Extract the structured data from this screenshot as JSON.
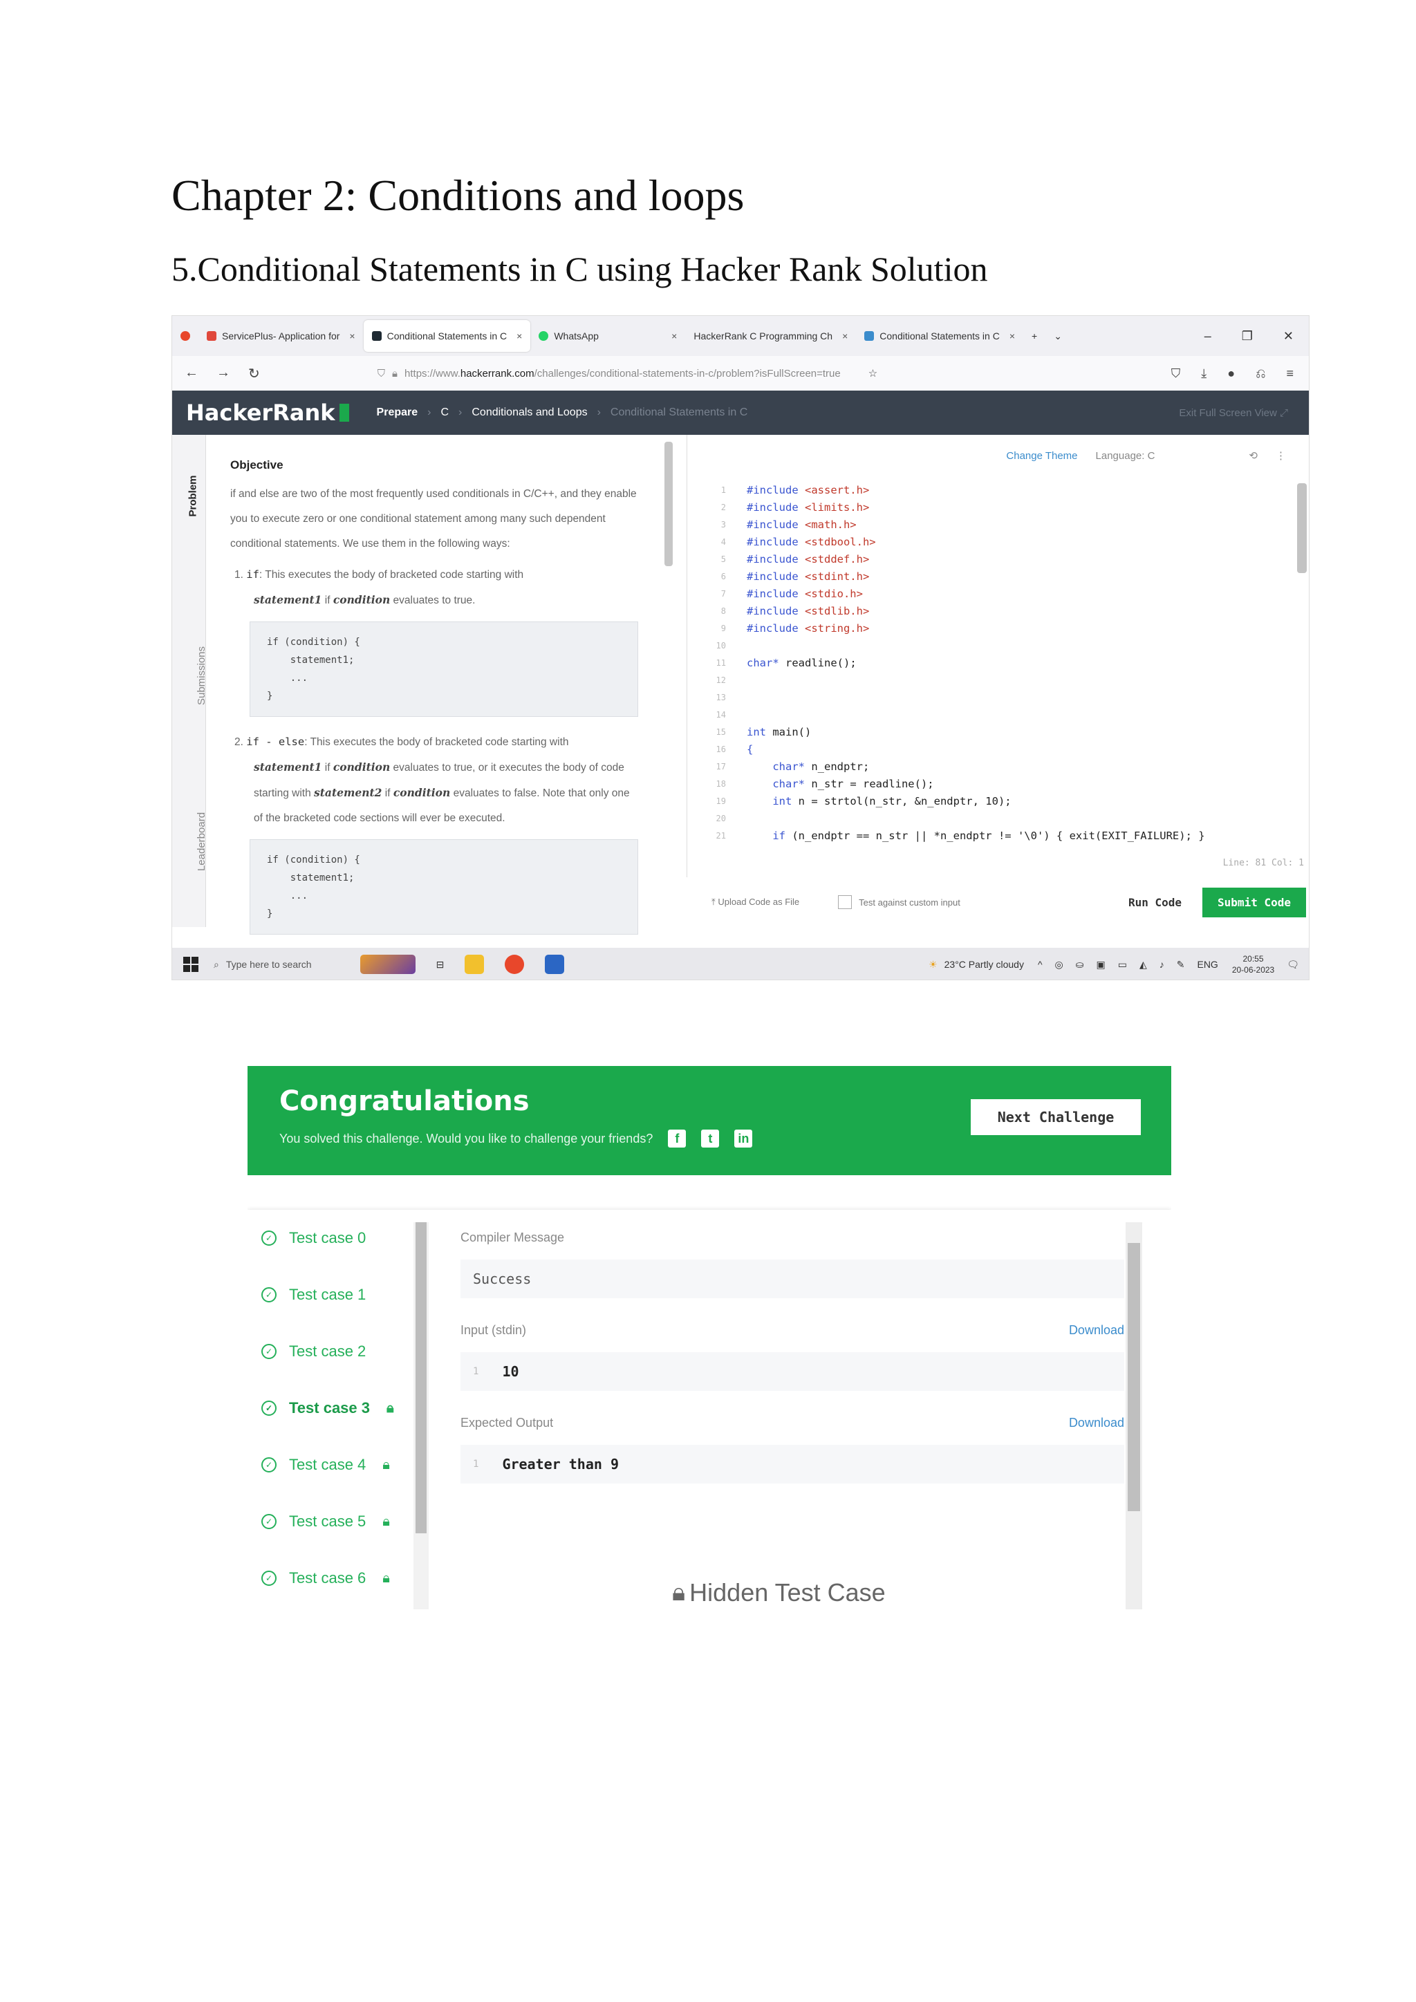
{
  "document": {
    "chapter_title": "Chapter 2: Conditions and loops",
    "section_title": "5.Conditional Statements in C using Hacker Rank Solution"
  },
  "browser": {
    "tabs": [
      {
        "label": "ServicePlus- Application for"
      },
      {
        "label": "Conditional Statements in C"
      },
      {
        "label": "WhatsApp"
      },
      {
        "label": "HackerRank C Programming Ch"
      },
      {
        "label": "Conditional Statements in C"
      }
    ],
    "url_prefix": "https://www.",
    "url_domain": "hackerrank.com",
    "url_path": "/challenges/conditional-statements-in-c/problem?isFullScreen=true"
  },
  "hackerrank": {
    "logo": "HackerRank",
    "breadcrumb": [
      "Prepare",
      "C",
      "Conditionals and Loops",
      "Conditional Statements in C"
    ],
    "exit_fullscreen": "Exit Full Screen View",
    "side_tabs": [
      "Problem",
      "Submissions",
      "Leaderboard"
    ],
    "objective_heading": "Objective",
    "objective_text": "if and else are two of the most frequently used conditionals in C/C++, and they enable you to execute zero or one conditional statement among many such dependent conditional statements. We use them in the following ways:",
    "item1_kw": "if",
    "item1_text": ": This executes the body of bracketed code starting with",
    "item1_s1": "statement1",
    "item1_if": " if ",
    "item1_cond": "condition",
    "item1_end": " evaluates to true.",
    "code1": "if (condition) {\n    statement1;\n    ...\n}",
    "item2_kw": "if - else",
    "item2_text": ": This executes the body of bracketed code starting with",
    "item2_s1": "statement1",
    "item2_mid": " if ",
    "item2_cond": "condition",
    "item2_a": " evaluates to true, or it executes the body of code starting with ",
    "item2_s2": "statement2",
    "item2_b": " if ",
    "item2_cond2": "condition",
    "item2_c": " evaluates to false. Note that only one of the bracketed code sections will ever be executed.",
    "code2": "if (condition) {\n    statement1;\n    ...\n}"
  },
  "editor": {
    "change_theme": "Change Theme",
    "language_label": "Language: C",
    "code_lines": [
      {
        "n": "1",
        "pre": "#include",
        "arg": " <assert.h>"
      },
      {
        "n": "2",
        "pre": "#include",
        "arg": " <limits.h>"
      },
      {
        "n": "3",
        "pre": "#include",
        "arg": " <math.h>"
      },
      {
        "n": "4",
        "pre": "#include",
        "arg": " <stdbool.h>"
      },
      {
        "n": "5",
        "pre": "#include",
        "arg": " <stddef.h>"
      },
      {
        "n": "6",
        "pre": "#include",
        "arg": " <stdint.h>"
      },
      {
        "n": "7",
        "pre": "#include",
        "arg": " <stdio.h>"
      },
      {
        "n": "8",
        "pre": "#include",
        "arg": " <stdlib.h>"
      },
      {
        "n": "9",
        "pre": "#include",
        "arg": " <string.h>"
      },
      {
        "n": "10",
        "pre": "",
        "arg": ""
      },
      {
        "n": "11",
        "pre": "char*",
        "arg": " readline();"
      },
      {
        "n": "12",
        "pre": "",
        "arg": ""
      },
      {
        "n": "13",
        "pre": "",
        "arg": ""
      },
      {
        "n": "14",
        "pre": "",
        "arg": ""
      },
      {
        "n": "15",
        "pre": "int",
        "arg": " main()"
      },
      {
        "n": "16",
        "pre": "{",
        "arg": ""
      },
      {
        "n": "17",
        "pre": "    char*",
        "arg": " n_endptr;"
      },
      {
        "n": "18",
        "pre": "    char*",
        "arg": " n_str = readline();"
      },
      {
        "n": "19",
        "pre": "    int",
        "arg": " n = strtol(n_str, &n_endptr, 10);"
      },
      {
        "n": "20",
        "pre": "",
        "arg": ""
      },
      {
        "n": "21",
        "pre": "    if",
        "arg": " (n_endptr == n_str || *n_endptr != '\\0') { exit(EXIT_FAILURE); }"
      }
    ],
    "line_col": "Line: 81 Col: 1",
    "upload": "Upload Code as File",
    "custom_input": "Test against custom input",
    "run": "Run Code",
    "submit": "Submit Code"
  },
  "taskbar": {
    "search": "Type here to search",
    "weather": "23°C  Partly cloudy",
    "lang": "ENG",
    "time": "20:55",
    "date": "20-06-2023"
  },
  "result": {
    "title": "Congratulations",
    "subtitle": "You solved this challenge. Would you like to challenge your friends?",
    "next": "Next Challenge",
    "test_cases": [
      "Test case 0",
      "Test case 1",
      "Test case 2",
      "Test case 3",
      "Test case 4",
      "Test case 5",
      "Test case 6"
    ],
    "compiler_label": "Compiler Message",
    "compiler_value": "Success",
    "input_label": "Input (stdin)",
    "download": "Download",
    "input_line_no": "1",
    "input_value": "10",
    "expected_label": "Expected Output",
    "expected_line_no": "1",
    "expected_value": "Greater than 9",
    "hidden": "Hidden Test Case"
  }
}
